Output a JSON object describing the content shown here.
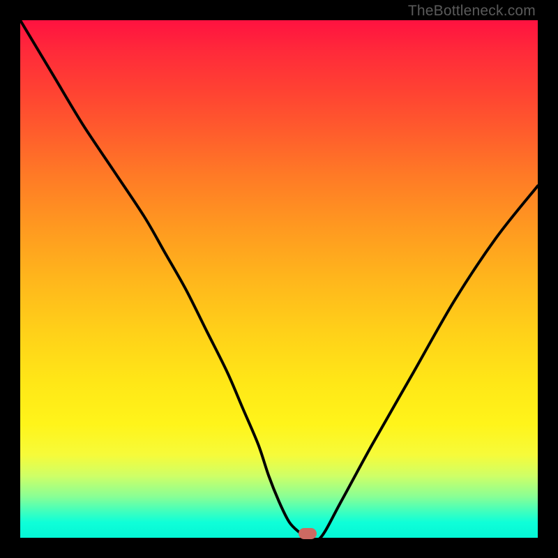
{
  "attribution": "TheBottleneck.com",
  "colors": {
    "page_bg": "#000000",
    "gradient_top": "#ff1240",
    "gradient_bottom": "#04f6d6",
    "curve": "#000000",
    "marker": "#cc6a62",
    "attribution_text": "#5a5a5a"
  },
  "chart_data": {
    "type": "line",
    "title": "",
    "xlabel": "",
    "ylabel": "",
    "xlim": [
      0,
      100
    ],
    "ylim": [
      0,
      100
    ],
    "grid": false,
    "series": [
      {
        "name": "bottleneck-curve",
        "x": [
          0,
          6,
          12,
          18,
          24,
          28,
          32,
          36,
          40,
          43,
          46,
          48,
          50,
          52,
          54,
          55.5,
          58,
          62,
          68,
          76,
          84,
          92,
          100
        ],
        "values": [
          100,
          90,
          80,
          71,
          62,
          55,
          48,
          40,
          32,
          25,
          18,
          12,
          7,
          3,
          1,
          0,
          0,
          7,
          18,
          32,
          46,
          58,
          68
        ]
      }
    ],
    "marker": {
      "x": 55.5,
      "y": 0.8,
      "shape": "pill"
    },
    "legend": false
  }
}
